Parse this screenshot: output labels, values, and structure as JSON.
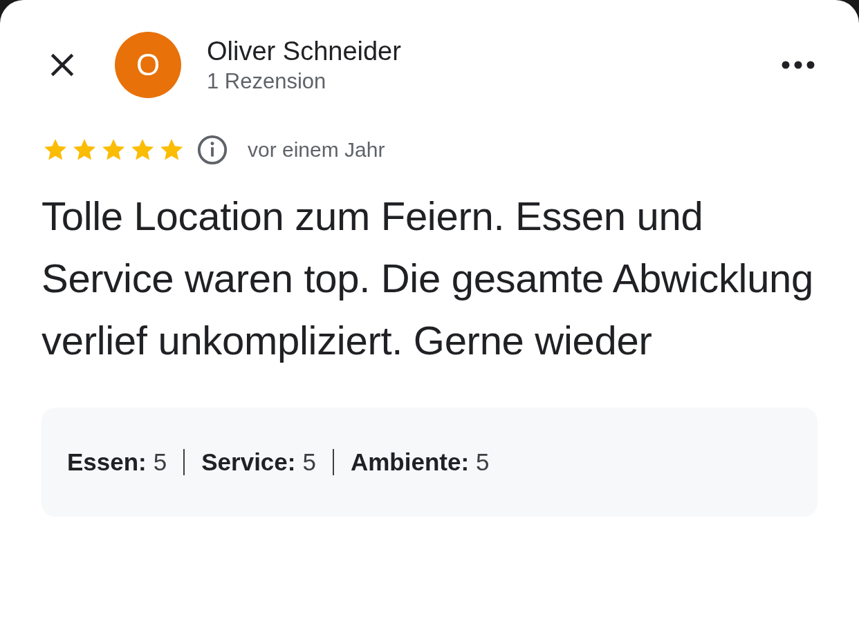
{
  "reviewer": {
    "initial": "O",
    "name": "Oliver Schneider",
    "review_count": "1 Rezension"
  },
  "review": {
    "stars": 5,
    "time": "vor einem Jahr",
    "text": "Tolle Location zum Feiern. Essen und Service waren top. Die gesamte Abwicklung verlief unkompliziert. Gerne wieder"
  },
  "ratings": [
    {
      "label": "Essen:",
      "value": "5"
    },
    {
      "label": "Service:",
      "value": "5"
    },
    {
      "label": "Ambiente:",
      "value": "5"
    }
  ]
}
